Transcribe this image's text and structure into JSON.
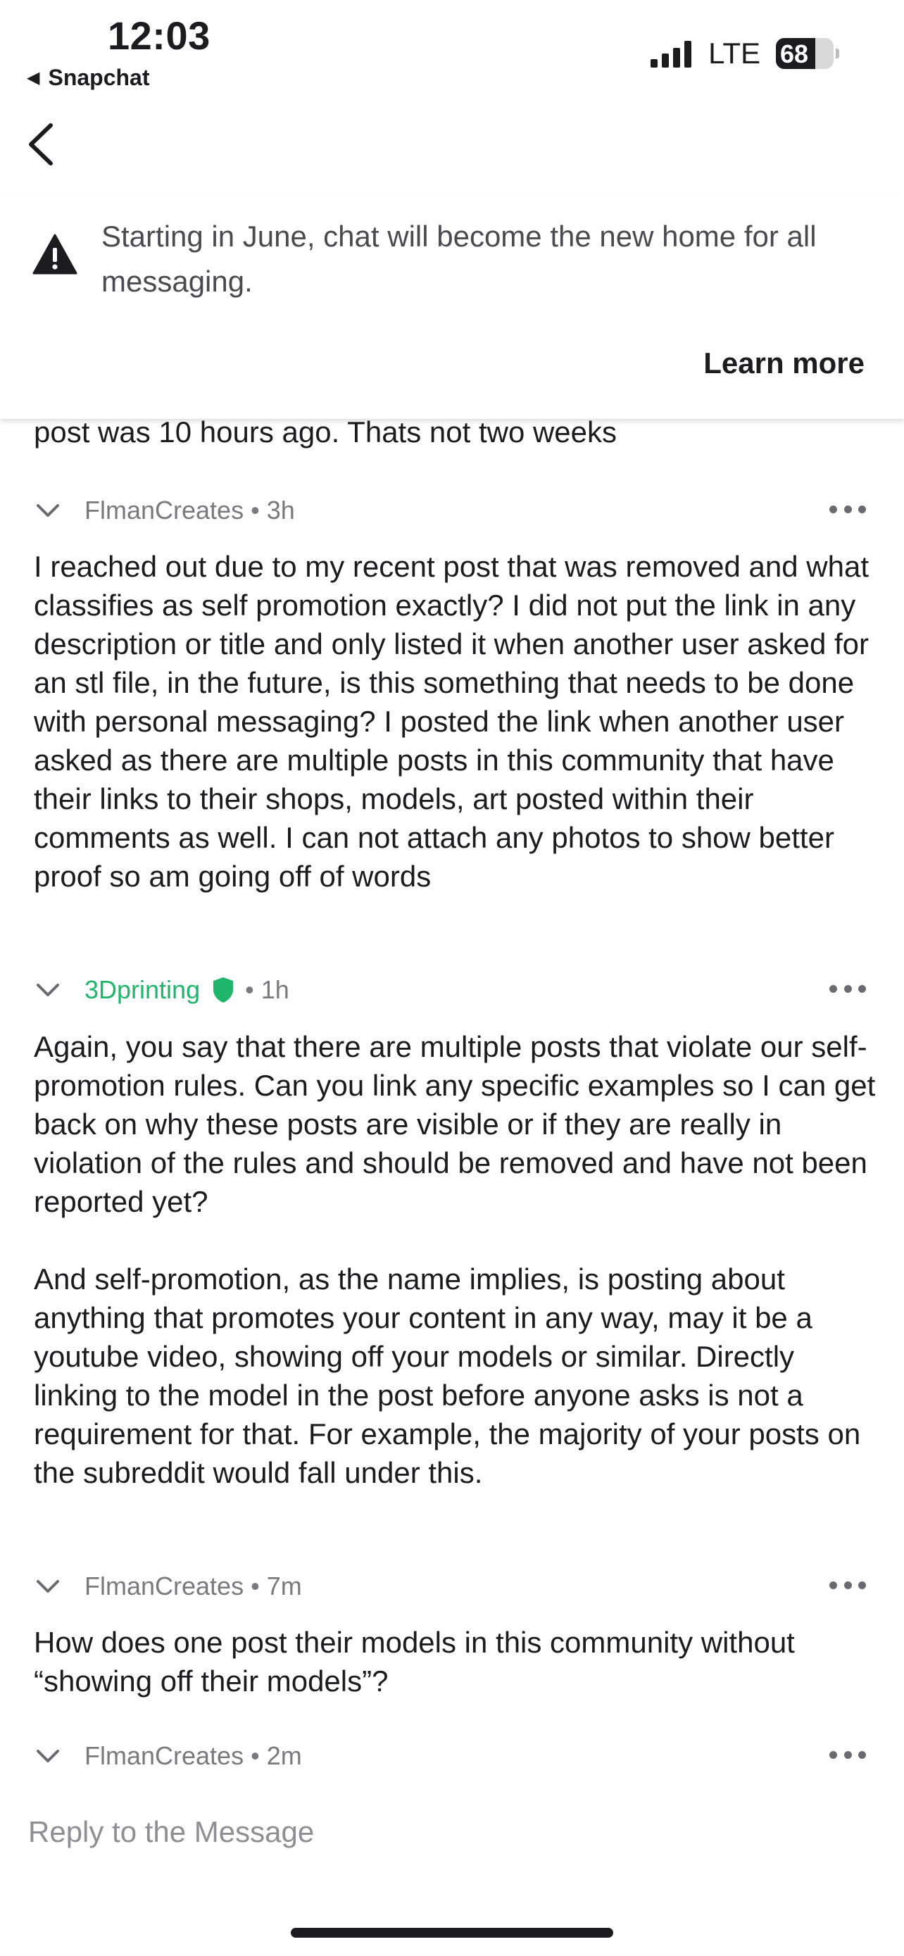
{
  "status_bar": {
    "time": "12:03",
    "back_app": "Snapchat",
    "network": "LTE",
    "battery": "68"
  },
  "banner": {
    "text": "Starting in June, chat will become the new home for all messaging.",
    "learn_more": "Learn more"
  },
  "cut_off_text": "post was 10 hours ago. Thats not two weeks",
  "messages": [
    {
      "author": "FlmanCreates",
      "time": "3h",
      "paragraphs": [
        "I reached out due to my recent post that was removed and what classifies as self promotion exactly? I did not put the link in any description or title and only listed it when another user asked for an stl file, in the future, is this something that needs to be done with personal messaging? I posted the link when another user asked as there are multiple posts in this community that have their links to their shops, models, art posted within their comments as well. I can not attach any photos to show better proof so am going off of words"
      ]
    },
    {
      "author": "3Dprinting",
      "time": "1h",
      "moderator": true,
      "paragraphs": [
        "Again, you say that there are multiple posts that violate our self-promotion rules. Can you link any specific examples so I can get back on why these posts are visible or if they are really in violation of the rules and should be removed and have not been reported yet?",
        "And self-promotion, as the name implies, is posting about anything that promotes your content in any way, may it be a youtube video, showing off your models or similar. Directly linking to the model in the post before anyone asks is not a requirement for that. For example, the majority of your posts on the subreddit would fall under this."
      ]
    },
    {
      "author": "FlmanCreates",
      "time": "7m",
      "paragraphs": [
        "How does one post their models in this community without “showing off their models”?"
      ]
    },
    {
      "author": "FlmanCreates",
      "time": "2m",
      "paragraphs": []
    }
  ],
  "separator": "•",
  "reply": {
    "placeholder": "Reply to the Message"
  },
  "colors": {
    "moderator_green": "#1fb56b",
    "meta_gray": "#7a7a7e",
    "text": "#1c1c1e"
  }
}
